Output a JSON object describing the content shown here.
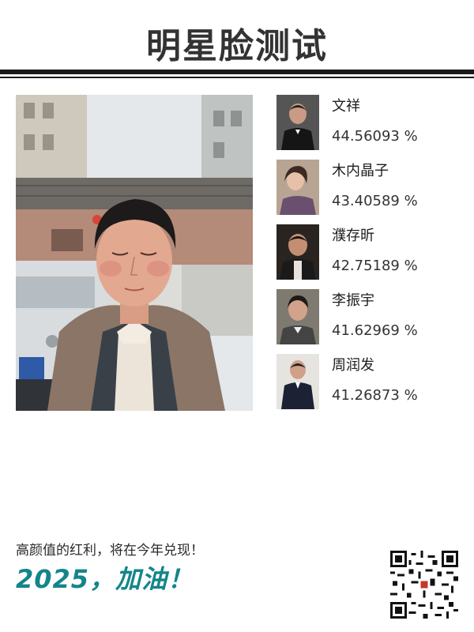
{
  "header": {
    "title": "明星脸测试"
  },
  "photo": {
    "subject": "user-portrait"
  },
  "results": [
    {
      "name": "文祥",
      "score": "44.56093 %"
    },
    {
      "name": "木内晶子",
      "score": "43.40589 %"
    },
    {
      "name": "濮存昕",
      "score": "42.75189 %"
    },
    {
      "name": "李振宇",
      "score": "41.62969 %"
    },
    {
      "name": "周润发",
      "score": "41.26873 %"
    }
  ],
  "footer": {
    "tagline": "高颜值的红利，将在今年兑现！",
    "slogan": "2025，加油！"
  },
  "colors": {
    "accent": "#14858a",
    "title": "#333333",
    "rule": "#1a1a1a"
  }
}
